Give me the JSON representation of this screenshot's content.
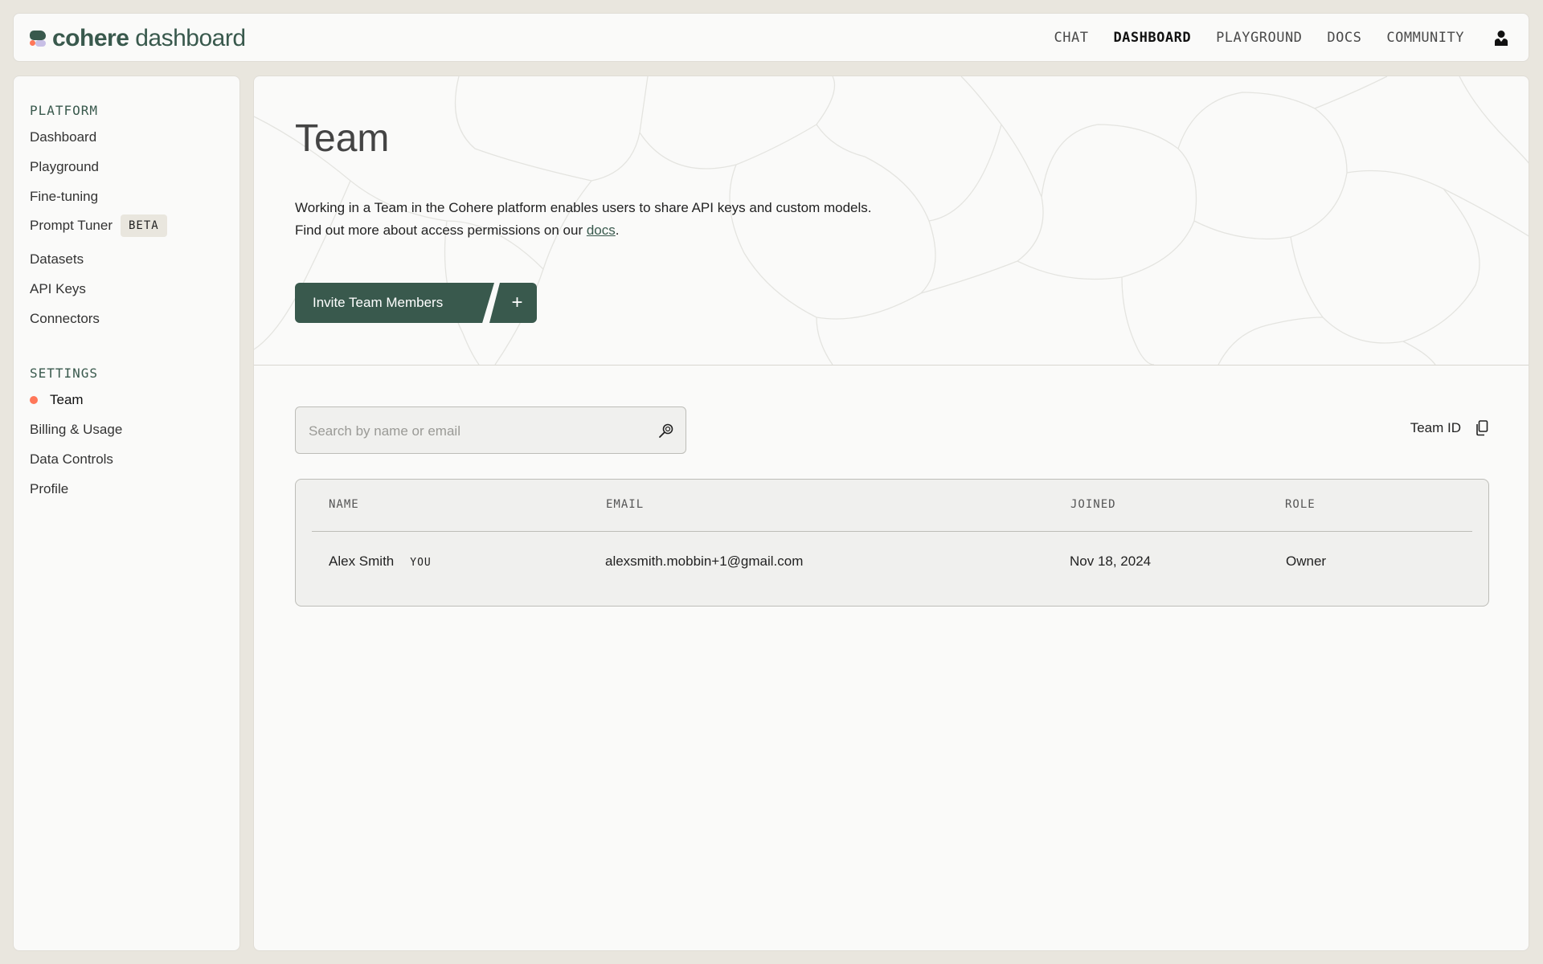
{
  "app": {
    "logo_bold": "cohere",
    "logo_light": " dashboard"
  },
  "nav": {
    "items": [
      {
        "label": "CHAT"
      },
      {
        "label": "DASHBOARD"
      },
      {
        "label": "PLAYGROUND"
      },
      {
        "label": "DOCS"
      },
      {
        "label": "COMMUNITY"
      }
    ],
    "active": "DASHBOARD"
  },
  "sidebar": {
    "platform_title": "PLATFORM",
    "platform_items": [
      {
        "label": "Dashboard"
      },
      {
        "label": "Playground"
      },
      {
        "label": "Fine-tuning"
      },
      {
        "label": "Prompt Tuner",
        "badge": "BETA"
      },
      {
        "label": "Datasets"
      },
      {
        "label": "API Keys"
      },
      {
        "label": "Connectors"
      }
    ],
    "settings_title": "SETTINGS",
    "settings_items": [
      {
        "label": "Team"
      },
      {
        "label": "Billing & Usage"
      },
      {
        "label": "Data Controls"
      },
      {
        "label": "Profile"
      }
    ],
    "active": "Team"
  },
  "page": {
    "title": "Team",
    "desc_line1": "Working in a Team in the Cohere platform enables users to share API keys and custom models.",
    "desc_line2_prefix": "Find out more about access permissions on our ",
    "desc_link": "docs",
    "desc_line2_suffix": ".",
    "invite_label": "Invite Team Members",
    "plus_label": "+"
  },
  "search": {
    "placeholder": "Search by name or email",
    "value": ""
  },
  "team_id_label": "Team ID",
  "table": {
    "headers": [
      "NAME",
      "EMAIL",
      "JOINED",
      "ROLE"
    ],
    "rows": [
      {
        "name": "Alex Smith",
        "tag": "YOU",
        "email": "alexsmith.mobbin+1@gmail.com",
        "joined": "Nov 18, 2024",
        "role": "Owner"
      }
    ]
  },
  "colors": {
    "brand_green": "#39594d",
    "accent_coral": "#ff7759",
    "background": "#e9e6de"
  }
}
